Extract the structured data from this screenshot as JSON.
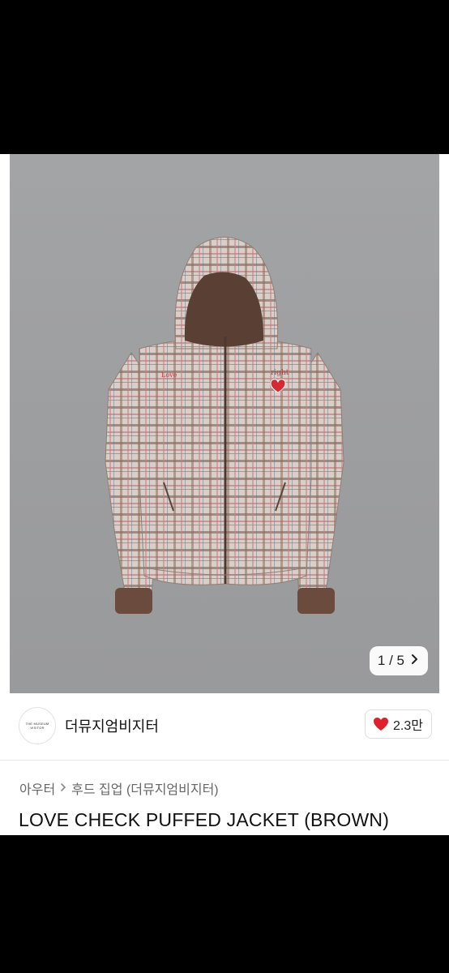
{
  "gallery": {
    "counter": "1 / 5",
    "next_icon": "chevron-right-icon",
    "embroidery_left": "Love",
    "embroidery_right": "right"
  },
  "seller": {
    "avatar_text": "THE MUSEUM VISITOR",
    "name": "더뮤지엄비지터",
    "likes": "2.3만",
    "like_icon": "heart-icon",
    "heart_color": "#e0202c"
  },
  "breadcrumb": {
    "category": "아우터",
    "subcategory": "후드 집업 (더뮤지엄비지터)"
  },
  "product": {
    "title": "LOVE CHECK PUFFED JACKET (BROWN)"
  }
}
